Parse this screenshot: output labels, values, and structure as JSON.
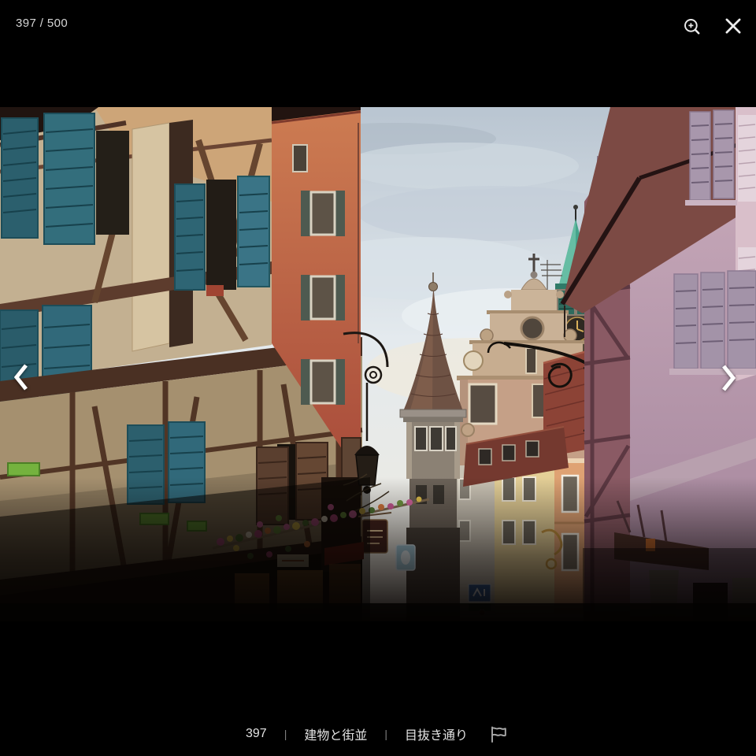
{
  "viewer": {
    "counter": "397 / 500",
    "background_color": "#000000"
  },
  "caption": {
    "number": "397",
    "separator": "|",
    "category": "建物と街並",
    "subcategory": "目抜き通り"
  },
  "photo": {
    "description": "Dusk view down a narrow old-town street in Alsace: half-timbered houses with teal shutters on the left, a slender conical turret spire, a scrolled baroque gable with a cross, a verdigris copper clock tower and red tiled roofs in the centre with an ornate wrought-iron shop sign, and a pink shuttered facade on the right; shopfronts and flower boxes sit in shadow below.",
    "palette": {
      "sky": "#dde5ea",
      "timber": "#5e3e30",
      "stucco": "#cdbb9d",
      "teal_shutters": "#2d6572",
      "terracotta": "#b4543e",
      "copper_spire": "#4fae96",
      "roof_tiles": "#8d4438",
      "pink_facade": "#c3a4b5",
      "flowers_pink": "#d465a0",
      "flowers_yellow": "#e5c44c",
      "planter_green": "#74b23e"
    }
  }
}
